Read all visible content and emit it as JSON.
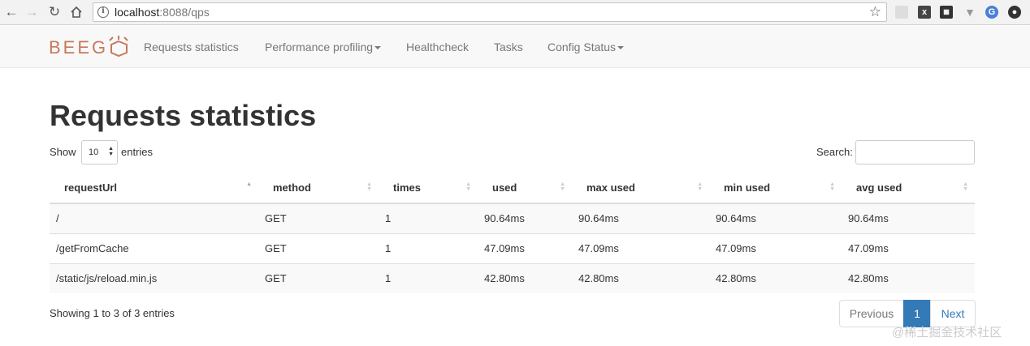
{
  "browser": {
    "url_host": "localhost",
    "url_rest": ":8088/qps",
    "icons": [
      "back-icon",
      "forward-icon",
      "reload-icon",
      "home-icon",
      "info-icon",
      "bookmark-star-icon"
    ]
  },
  "navbar": {
    "brand": "BEEGO",
    "items": [
      {
        "label": "Requests statistics"
      },
      {
        "label": "Performance profiling"
      },
      {
        "label": "Healthcheck"
      },
      {
        "label": "Tasks"
      },
      {
        "label": "Config Status"
      }
    ]
  },
  "page": {
    "title": "Requests statistics",
    "show_label": "Show",
    "page_length": "10",
    "entries_label": "entries",
    "search_label": "Search:"
  },
  "table": {
    "headers": [
      "requestUrl",
      "method",
      "times",
      "used",
      "max used",
      "min used",
      "avg used"
    ],
    "rows": [
      [
        "/",
        "GET",
        "1",
        "90.64ms",
        "90.64ms",
        "90.64ms",
        "90.64ms"
      ],
      [
        "/getFromCache",
        "GET",
        "1",
        "47.09ms",
        "47.09ms",
        "47.09ms",
        "47.09ms"
      ],
      [
        "/static/js/reload.min.js",
        "GET",
        "1",
        "42.80ms",
        "42.80ms",
        "42.80ms",
        "42.80ms"
      ]
    ]
  },
  "footer": {
    "info": "Showing 1 to 3 of 3 entries",
    "previous": "Previous",
    "current_page": "1",
    "next": "Next"
  },
  "watermark": "@稀土掘金技术社区",
  "colors": {
    "brand": "#c8785a",
    "accent": "#337ab7"
  }
}
